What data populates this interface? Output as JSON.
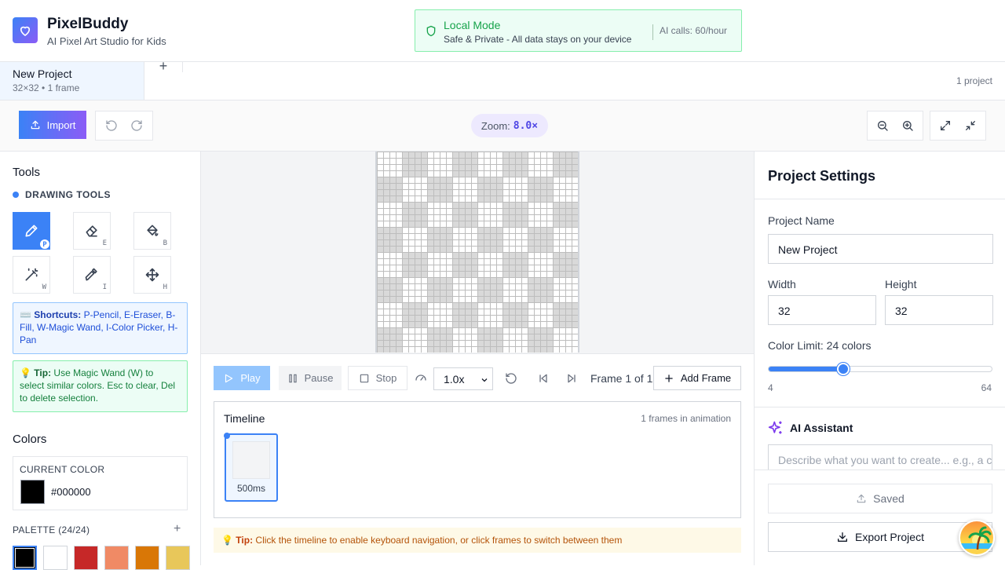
{
  "app": {
    "title": "PixelBuddy",
    "subtitle": "AI Pixel Art Studio for Kids",
    "brand_color": "#6366f1"
  },
  "local_mode": {
    "title": "Local Mode",
    "subtitle": "Safe & Private - All data stays on your device",
    "ai_calls": "AI calls: 60/hour"
  },
  "tabs": {
    "items": [
      {
        "name": "New Project",
        "meta": "32×32 • 1 frame"
      }
    ],
    "add_label": "+",
    "project_count": "1 project"
  },
  "toolbar": {
    "import_label": "Import",
    "zoom_label": "Zoom:",
    "zoom_value": "8.0×"
  },
  "tools": {
    "title": "Tools",
    "drawing_header": "DRAWING TOOLS",
    "items": [
      {
        "name": "pencil",
        "key": "P",
        "active": true
      },
      {
        "name": "eraser",
        "key": "E"
      },
      {
        "name": "fill",
        "key": "B"
      },
      {
        "name": "magic-wand",
        "key": "W"
      },
      {
        "name": "color-picker",
        "key": "I"
      },
      {
        "name": "pan",
        "key": "H"
      }
    ],
    "shortcuts_label": "Shortcuts:",
    "shortcuts_text": "P-Pencil, E-Eraser, B-Fill, W-Magic Wand, I-Color Picker, H-Pan",
    "tip_label": "Tip:",
    "tip_text": "Use Magic Wand (W) to select similar colors. Esc to clear, Del to delete selection."
  },
  "colors": {
    "title": "Colors",
    "current_label": "CURRENT COLOR",
    "current_hex": "#000000",
    "palette_label": "PALETTE (24/24)",
    "palette_add": "+",
    "palette": [
      "#000000",
      "#ffffff",
      "#c62828",
      "#f08a65",
      "#d97706",
      "#e8c75a"
    ]
  },
  "playback": {
    "play_label": "Play",
    "pause_label": "Pause",
    "stop_label": "Stop",
    "speed_value": "1.0x",
    "frame_text": "Frame 1 of 1",
    "add_frame_label": "Add Frame"
  },
  "timeline": {
    "title": "Timeline",
    "count_text": "1 frames in animation",
    "frames": [
      {
        "duration": "500ms"
      }
    ]
  },
  "tip_bar": {
    "label": "Tip:",
    "text": "Click the timeline to enable keyboard navigation, or click frames to switch between them"
  },
  "settings": {
    "title": "Project Settings",
    "name_label": "Project Name",
    "name_value": "New Project",
    "width_label": "Width",
    "width_value": "32",
    "height_label": "Height",
    "height_value": "32",
    "color_limit_label": "Color Limit: 24 colors",
    "color_limit_value": 24,
    "color_limit_min": "4",
    "color_limit_max": "64",
    "ai_title": "AI Assistant",
    "ai_placeholder": "Describe what you want to create... e.g., a cute cat",
    "saved_label": "Saved",
    "export_label": "Export Project"
  }
}
